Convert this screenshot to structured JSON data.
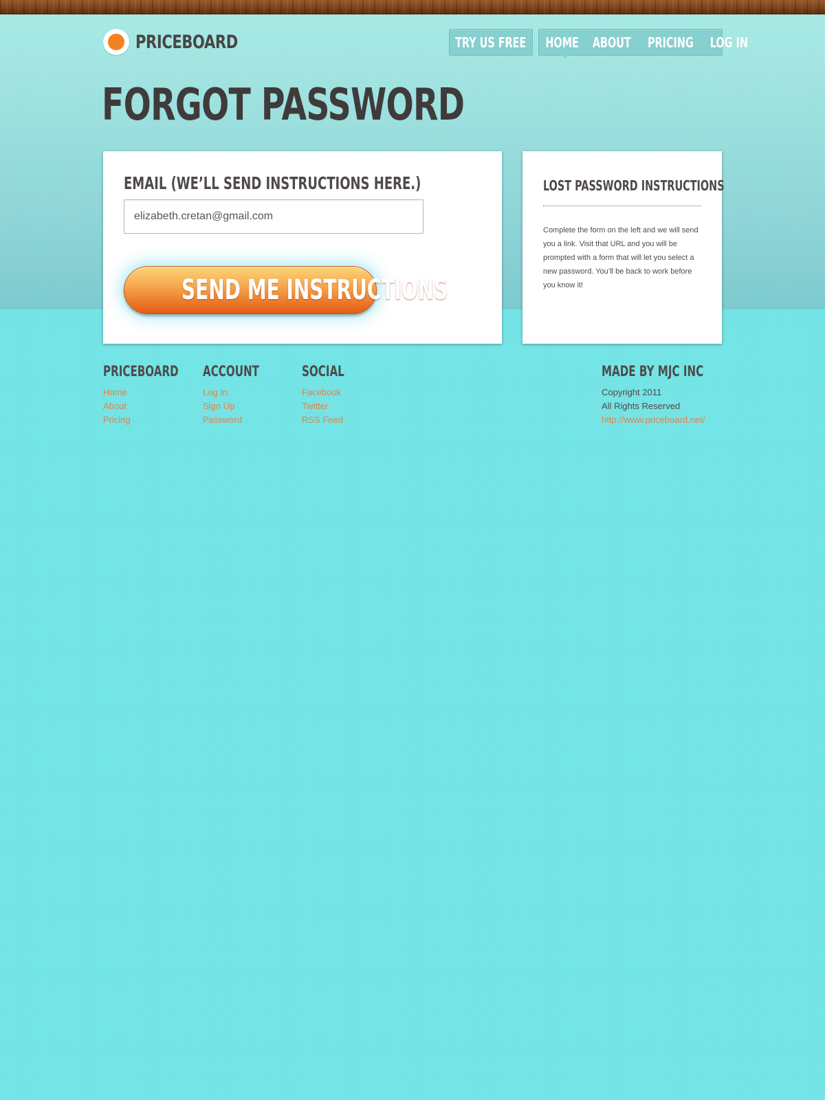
{
  "brand": {
    "name": "PRICEBOARD",
    "logo_icon": "orange-circle-logo-icon",
    "accent": "#f6821f"
  },
  "nav": {
    "cta_label": "TRY US FREE",
    "items": [
      {
        "label": "HOME"
      },
      {
        "label": "ABOUT"
      },
      {
        "label": "PRICING"
      },
      {
        "label": "LOG IN"
      }
    ],
    "active": "HOME"
  },
  "page": {
    "title": "FORGOT PASSWORD"
  },
  "form": {
    "email_label": "EMAIL (WE’LL SEND INSTRUCTIONS HERE.)",
    "email_value": "elizabeth.cretan@gmail.com",
    "submit_label": "SEND ME INSTRUCTIONS"
  },
  "sidebar": {
    "title": "LOST PASSWORD INSTRUCTIONS",
    "body": "Complete the form on the left and we will send you a link. Visit that URL and you will be prompted with a form that will let you select a new password. You’ll be back to work before you know it!"
  },
  "footer": {
    "columns": [
      {
        "heading": "PRICEBOARD",
        "links": [
          "Home",
          "About",
          "Pricing"
        ]
      },
      {
        "heading": "ACCOUNT",
        "links": [
          "Log In",
          "Sign Up",
          "Password"
        ]
      },
      {
        "heading": "SOCIAL",
        "links": [
          "Facebook",
          "Twitter",
          "RSS Feed"
        ]
      },
      {
        "heading": "MADE BY MJC INC",
        "lines": [
          "Copyright 2011",
          "All Rights Reserved"
        ],
        "link": "http://www.priceboard.net/"
      }
    ]
  },
  "colors": {
    "link": "#e1834b",
    "text": "#4f4a49",
    "background": "#73e5e7",
    "button_orange": "#ec7a2c"
  }
}
